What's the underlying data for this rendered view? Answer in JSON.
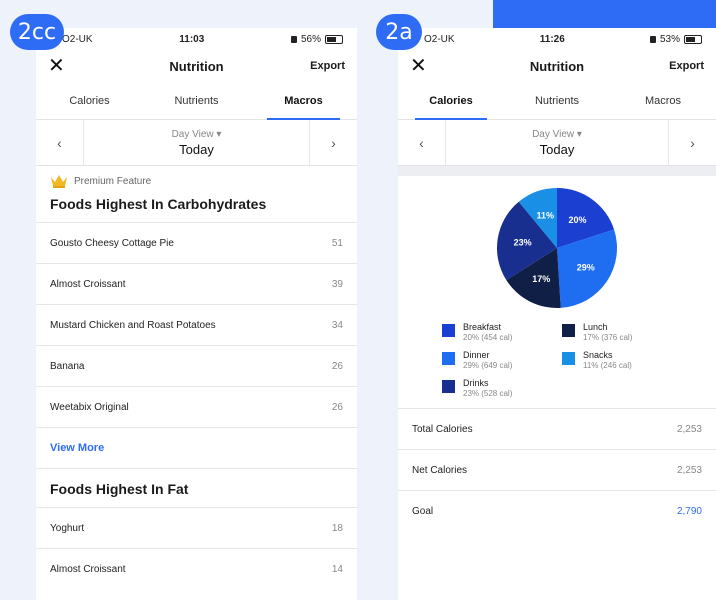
{
  "colors": {
    "accent": "#2f6cf6",
    "breakfast": "#1b3fd1",
    "lunch": "#0f1f45",
    "dinner": "#1f6ef2",
    "snacks": "#1a8fe6",
    "drinks": "#182f8f"
  },
  "badges": {
    "left": "2cc",
    "right": "2a"
  },
  "left": {
    "status": {
      "carrier": "O2-UK",
      "time": "11:03",
      "battery": "56%"
    },
    "nav": {
      "close_icon": "close-icon",
      "title": "Nutrition",
      "export": "Export"
    },
    "tabs": [
      "Calories",
      "Nutrients",
      "Macros"
    ],
    "active_tab": "Macros",
    "dayview": {
      "label": "Day View",
      "value": "Today"
    },
    "premium_label": "Premium Feature",
    "carbs_title": "Foods Highest In Carbohydrates",
    "carbs": [
      {
        "name": "Gousto Cheesy Cottage Pie",
        "value": "51"
      },
      {
        "name": "Almost Croissant",
        "value": "39"
      },
      {
        "name": "Mustard Chicken and Roast Potatoes",
        "value": "34"
      },
      {
        "name": "Banana",
        "value": "26"
      },
      {
        "name": "Weetabix Original",
        "value": "26"
      }
    ],
    "view_more": "View More",
    "fat_title": "Foods Highest In Fat",
    "fat": [
      {
        "name": "Yoghurt",
        "value": "18"
      },
      {
        "name": "Almost Croissant",
        "value": "14"
      }
    ]
  },
  "right": {
    "status": {
      "carrier": "O2-UK",
      "time": "11:26",
      "battery": "53%"
    },
    "nav": {
      "close_icon": "close-icon",
      "title": "Nutrition",
      "export": "Export"
    },
    "tabs": [
      "Calories",
      "Nutrients",
      "Macros"
    ],
    "active_tab": "Calories",
    "dayview": {
      "label": "Day View",
      "value": "Today"
    },
    "legend": [
      {
        "name": "Breakfast",
        "sub": "20% (454 cal)"
      },
      {
        "name": "Lunch",
        "sub": "17% (376 cal)"
      },
      {
        "name": "Dinner",
        "sub": "29% (649 cal)"
      },
      {
        "name": "Snacks",
        "sub": "11% (246 cal)"
      },
      {
        "name": "Drinks",
        "sub": "23% (528 cal)"
      }
    ],
    "totals": [
      {
        "label": "Total Calories",
        "value": "2,253"
      },
      {
        "label": "Net Calories",
        "value": "2,253"
      },
      {
        "label": "Goal",
        "value": "2,790"
      }
    ]
  },
  "chart_data": {
    "type": "pie",
    "categories": [
      "Breakfast",
      "Dinner",
      "Lunch",
      "Drinks",
      "Snacks"
    ],
    "values": [
      20,
      29,
      17,
      23,
      11
    ],
    "labels": [
      "20%",
      "29%",
      "17%",
      "23%",
      "11%"
    ],
    "colors": [
      "#1b3fd1",
      "#1f6ef2",
      "#0f1f45",
      "#182f8f",
      "#1a8fe6"
    ],
    "legend": "below"
  }
}
